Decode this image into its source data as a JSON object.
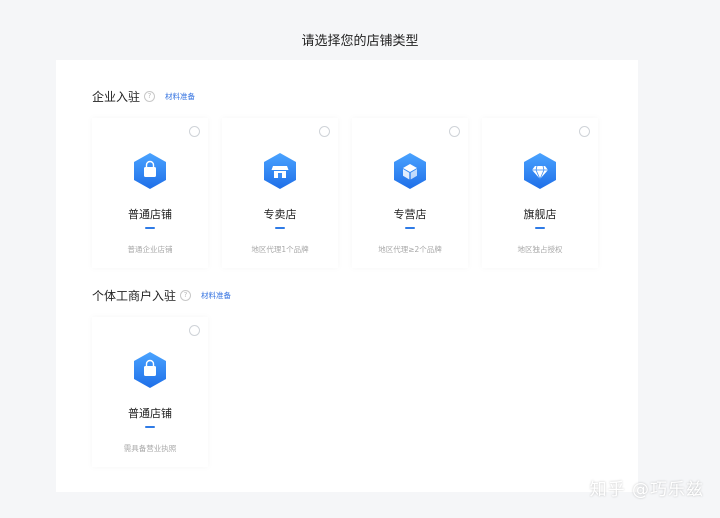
{
  "page_title": "请选择您的店铺类型",
  "sections": [
    {
      "title": "企业入驻",
      "link": "材料准备",
      "cards": [
        {
          "title": "普通店铺",
          "desc": "普通企业店铺",
          "icon": "shopping-bag-icon"
        },
        {
          "title": "专卖店",
          "desc": "地区代理1个品牌",
          "icon": "storefront-icon"
        },
        {
          "title": "专营店",
          "desc": "地区代理≥2个品牌",
          "icon": "box-icon"
        },
        {
          "title": "旗舰店",
          "desc": "地区独占授权",
          "icon": "diamond-icon"
        }
      ]
    },
    {
      "title": "个体工商户入驻",
      "link": "材料准备",
      "cards": [
        {
          "title": "普通店铺",
          "desc": "需具备营业执照",
          "icon": "shopping-bag-icon"
        }
      ]
    }
  ],
  "watermark": "知乎 @巧乐兹",
  "colors": {
    "accent": "#2f7be6",
    "icon_gradient_top": "#4aa3ff",
    "icon_gradient_bottom": "#1f6fe8"
  }
}
